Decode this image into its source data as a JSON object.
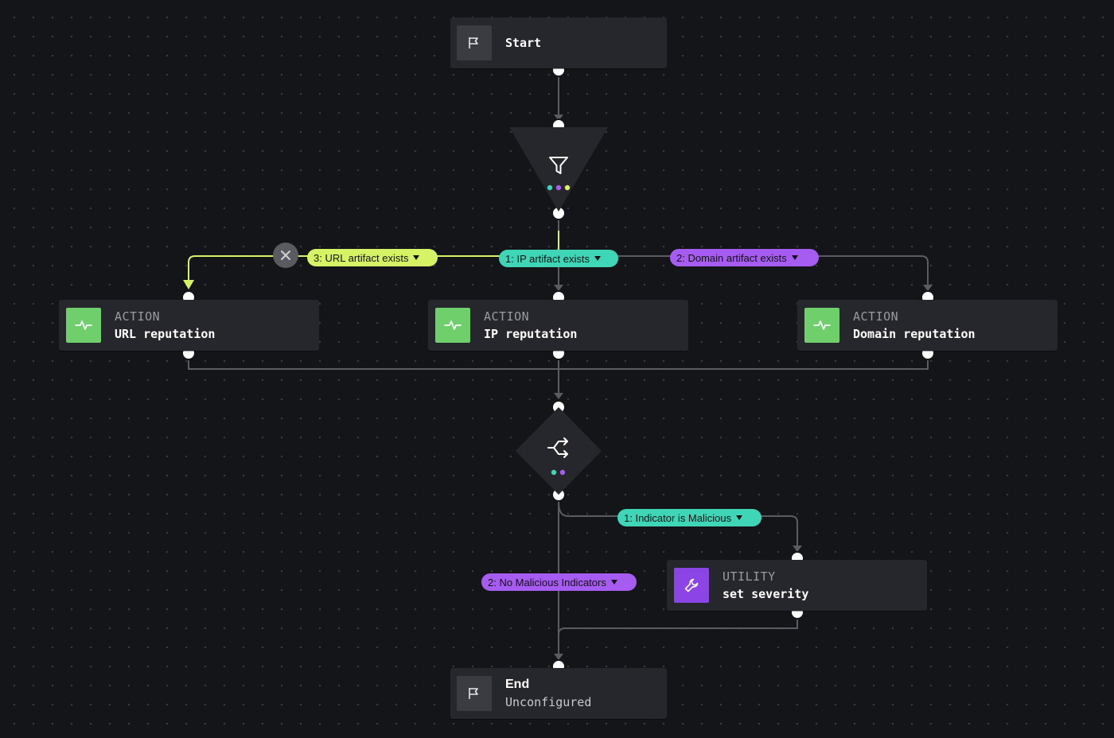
{
  "nodes": {
    "start": {
      "label": "Start",
      "icon": "flag-icon"
    },
    "filter": {
      "icon": "filter-icon"
    },
    "action_url": {
      "kind": "ACTION",
      "name": "URL reputation",
      "icon": "activity-icon"
    },
    "action_ip": {
      "kind": "ACTION",
      "name": "IP reputation",
      "icon": "activity-icon"
    },
    "action_domain": {
      "kind": "ACTION",
      "name": "Domain reputation",
      "icon": "activity-icon"
    },
    "decision": {
      "icon": "split-icon"
    },
    "utility": {
      "kind": "UTILITY",
      "name": "set severity",
      "icon": "wrench-icon"
    },
    "end": {
      "label": "End",
      "status": "Unconfigured",
      "icon": "flag-icon"
    }
  },
  "branches": {
    "url_artifact": "3: URL artifact exists",
    "ip_artifact": "1: IP artifact exists",
    "domain_artifact": "2: Domain artifact exists",
    "malicious": "1: Indicator is Malicious",
    "not_malicious": "2: No Malicious Indicators"
  },
  "colors": {
    "background": "#141518",
    "node": "#26272c",
    "wire": "#5b5c62",
    "lime": "#d6f265",
    "teal": "#3ed6b6",
    "violet": "#a65cf0",
    "action_green": "#6fcf6b",
    "utility_purple": "#8b45e6"
  }
}
